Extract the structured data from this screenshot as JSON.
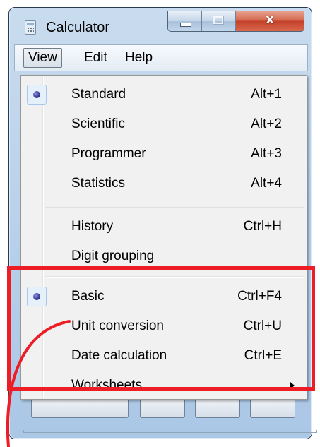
{
  "window": {
    "title": "Calculator"
  },
  "caption_buttons": {
    "close_glyph": "x"
  },
  "menubar": {
    "items": [
      "View",
      "Edit",
      "Help"
    ]
  },
  "view_menu": {
    "groups": [
      [
        {
          "label": "Standard",
          "shortcut": "Alt+1",
          "checked": true
        },
        {
          "label": "Scientific",
          "shortcut": "Alt+2",
          "checked": false
        },
        {
          "label": "Programmer",
          "shortcut": "Alt+3",
          "checked": false
        },
        {
          "label": "Statistics",
          "shortcut": "Alt+4",
          "checked": false
        }
      ],
      [
        {
          "label": "History",
          "shortcut": "Ctrl+H",
          "checked": false
        },
        {
          "label": "Digit grouping",
          "shortcut": "",
          "checked": false
        }
      ],
      [
        {
          "label": "Basic",
          "shortcut": "Ctrl+F4",
          "checked": true
        },
        {
          "label": "Unit conversion",
          "shortcut": "Ctrl+U",
          "checked": false
        },
        {
          "label": "Date calculation",
          "shortcut": "Ctrl+E",
          "checked": false
        },
        {
          "label": "Worksheets",
          "shortcut": "",
          "checked": false,
          "submenu": true
        }
      ]
    ]
  },
  "annotation": {
    "highlight_color": "#ee1c24",
    "arrow_color": "#ee1c24"
  },
  "colors": {
    "radio_dot": "#262a8a",
    "close_button": "#c4412a"
  }
}
